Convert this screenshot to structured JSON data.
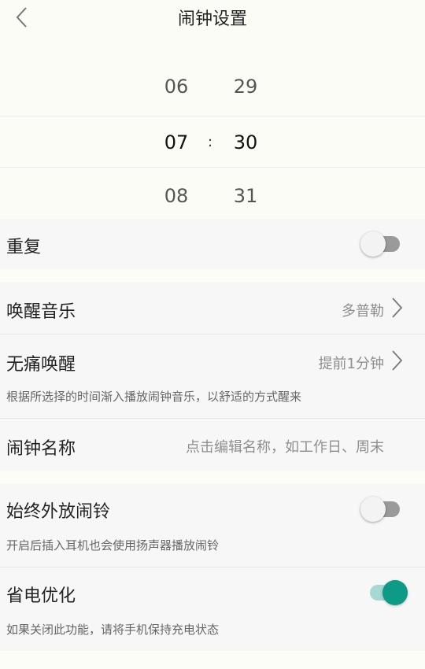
{
  "header": {
    "title": "闹钟设置",
    "back_icon": "chevron-left-icon"
  },
  "picker": {
    "hours": [
      "06",
      "07",
      "08"
    ],
    "minutes": [
      "29",
      "30",
      "31"
    ],
    "separator": ":",
    "selected_hour": "07",
    "selected_minute": "30"
  },
  "repeat": {
    "label": "重复",
    "enabled": false
  },
  "wake_music": {
    "label": "唤醒音乐",
    "value": "多普勒"
  },
  "gentle_wake": {
    "label": "无痛唤醒",
    "value": "提前1分钟",
    "description": "根据所选择的时间渐入播放闹钟音乐，以舒适的方式醒来"
  },
  "alarm_name": {
    "label": "闹钟名称",
    "placeholder": "点击编辑名称，如工作日、周末"
  },
  "speaker": {
    "label": "始终外放闹铃",
    "description": "开启后插入耳机也会使用扬声器播放闹铃",
    "enabled": false
  },
  "power_saving": {
    "label": "省电优化",
    "description": "如果关闭此功能，请将手机保持充电状态",
    "enabled": true
  },
  "colors": {
    "accent": "#0d9a86",
    "accent_track": "#a6d9d2",
    "toggle_off": "#9a9a9a"
  }
}
